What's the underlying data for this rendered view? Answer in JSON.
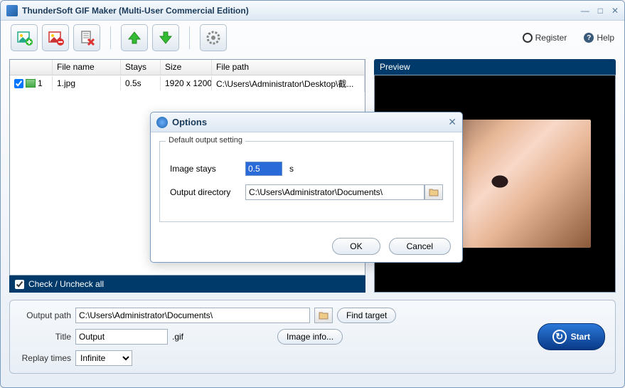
{
  "title": "ThunderSoft GIF Maker (Multi-User Commercial Edition)",
  "toolbar": {
    "register": "Register",
    "help": "Help"
  },
  "list": {
    "headers": {
      "filename": "File name",
      "stays": "Stays",
      "size": "Size",
      "filepath": "File path"
    },
    "rows": [
      {
        "index": "1",
        "name": "1.jpg",
        "stays": "0.5s",
        "size": "1920 x 1200",
        "path": "C:\\Users\\Administrator\\Desktop\\截..."
      }
    ],
    "check_all": "Check / Uncheck all"
  },
  "preview": {
    "title": "Preview"
  },
  "options_dialog": {
    "title": "Options",
    "legend": "Default output setting",
    "image_stays_label": "Image stays",
    "image_stays_value": "0.5",
    "image_stays_unit": "s",
    "output_dir_label": "Output directory",
    "output_dir_value": "C:\\Users\\Administrator\\Documents\\",
    "ok": "OK",
    "cancel": "Cancel"
  },
  "bottom": {
    "output_path_label": "Output path",
    "output_path_value": "C:\\Users\\Administrator\\Documents\\",
    "find_target": "Find target",
    "title_label": "Title",
    "title_value": "Output",
    "title_ext": ".gif",
    "image_info": "Image info...",
    "replay_label": "Replay times",
    "replay_value": "Infinite",
    "start": "Start"
  }
}
